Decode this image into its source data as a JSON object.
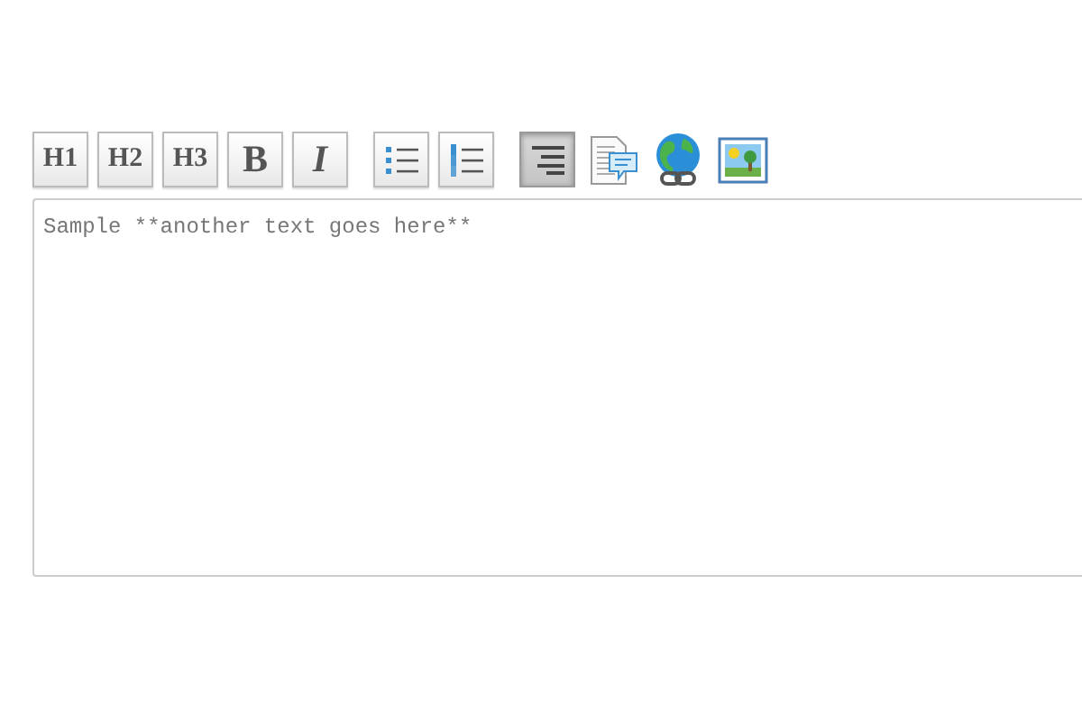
{
  "toolbar_groups": [
    [
      {
        "kind": "heading",
        "label": "H1",
        "pressed": false
      },
      {
        "kind": "heading",
        "label": "H2",
        "pressed": false
      },
      {
        "kind": "heading",
        "label": "H3",
        "pressed": false
      },
      {
        "kind": "bold",
        "label": "B",
        "pressed": false
      },
      {
        "kind": "italic",
        "label": "I",
        "pressed": false
      }
    ],
    [
      {
        "kind": "bullet-list",
        "pressed": false
      },
      {
        "kind": "numbered-list",
        "pressed": false
      }
    ],
    [
      {
        "kind": "align",
        "pressed": true
      },
      {
        "kind": "comment",
        "pressed": false
      },
      {
        "kind": "link",
        "pressed": false
      },
      {
        "kind": "image",
        "pressed": false
      }
    ]
  ],
  "editor": {
    "value": "Sample **another text goes here**"
  }
}
